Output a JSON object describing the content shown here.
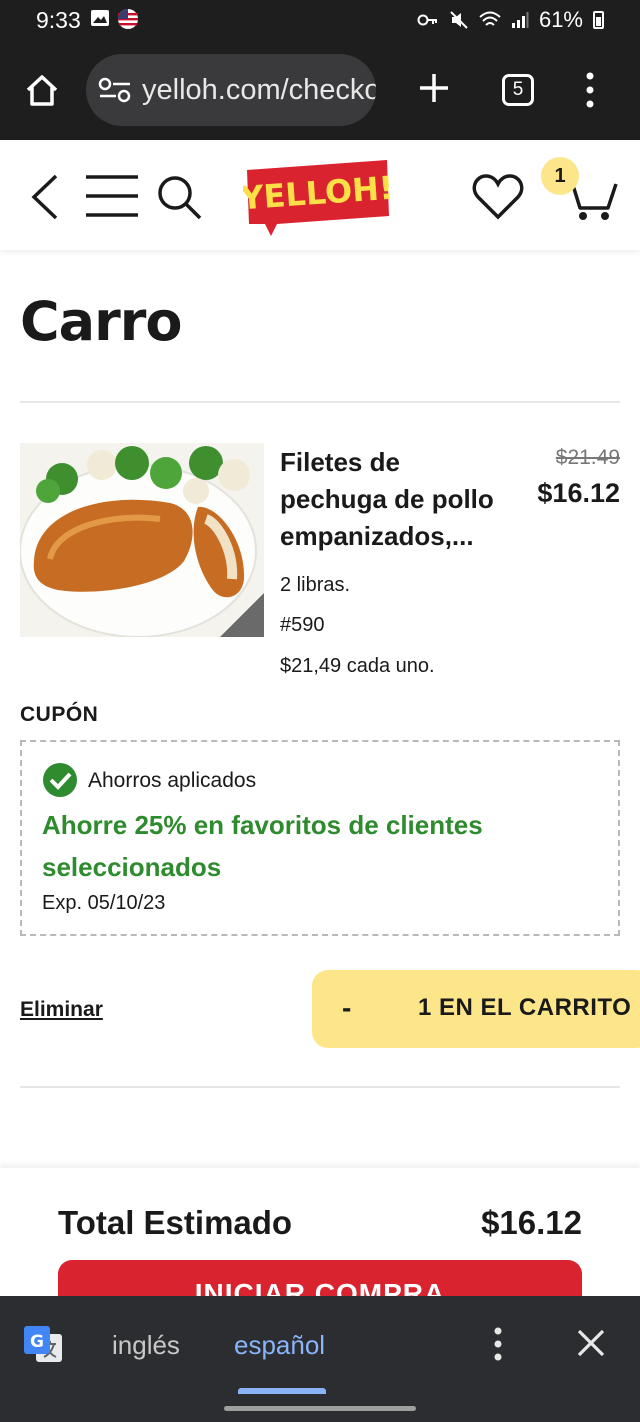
{
  "status_bar": {
    "time": "9:33",
    "battery": "61%"
  },
  "browser": {
    "url": "yelloh.com/checkout",
    "tab_count": "5"
  },
  "header": {
    "logo_text": "YELLOH!",
    "cart_count": "1"
  },
  "page": {
    "title": "Carro"
  },
  "cart_item": {
    "name": "Filetes de pechuga de pollo empanizados,...",
    "price_original": "$21.49",
    "price_current": "$16.12",
    "size": "2 libras.",
    "sku": "#590",
    "unit_price": "$21,49 cada uno."
  },
  "coupon": {
    "heading": "CUPÓN",
    "status": "Ahorros aplicados",
    "promo": "Ahorre 25% en favoritos de clientes seleccionados",
    "expiry": "Exp. 05/10/23"
  },
  "actions": {
    "remove": "Eliminar",
    "decrement": "-",
    "quantity_label": "1 EN EL CARRITO"
  },
  "summary": {
    "total_label": "Total Estimado",
    "total_value": "$16.12",
    "checkout": "INICIAR COMPRA"
  },
  "translate_bar": {
    "source_language": "inglés",
    "target_language": "español"
  },
  "colors": {
    "brand_red": "#d9232e",
    "accent_yellow": "#fde68a",
    "success_green": "#2e8b2e"
  }
}
